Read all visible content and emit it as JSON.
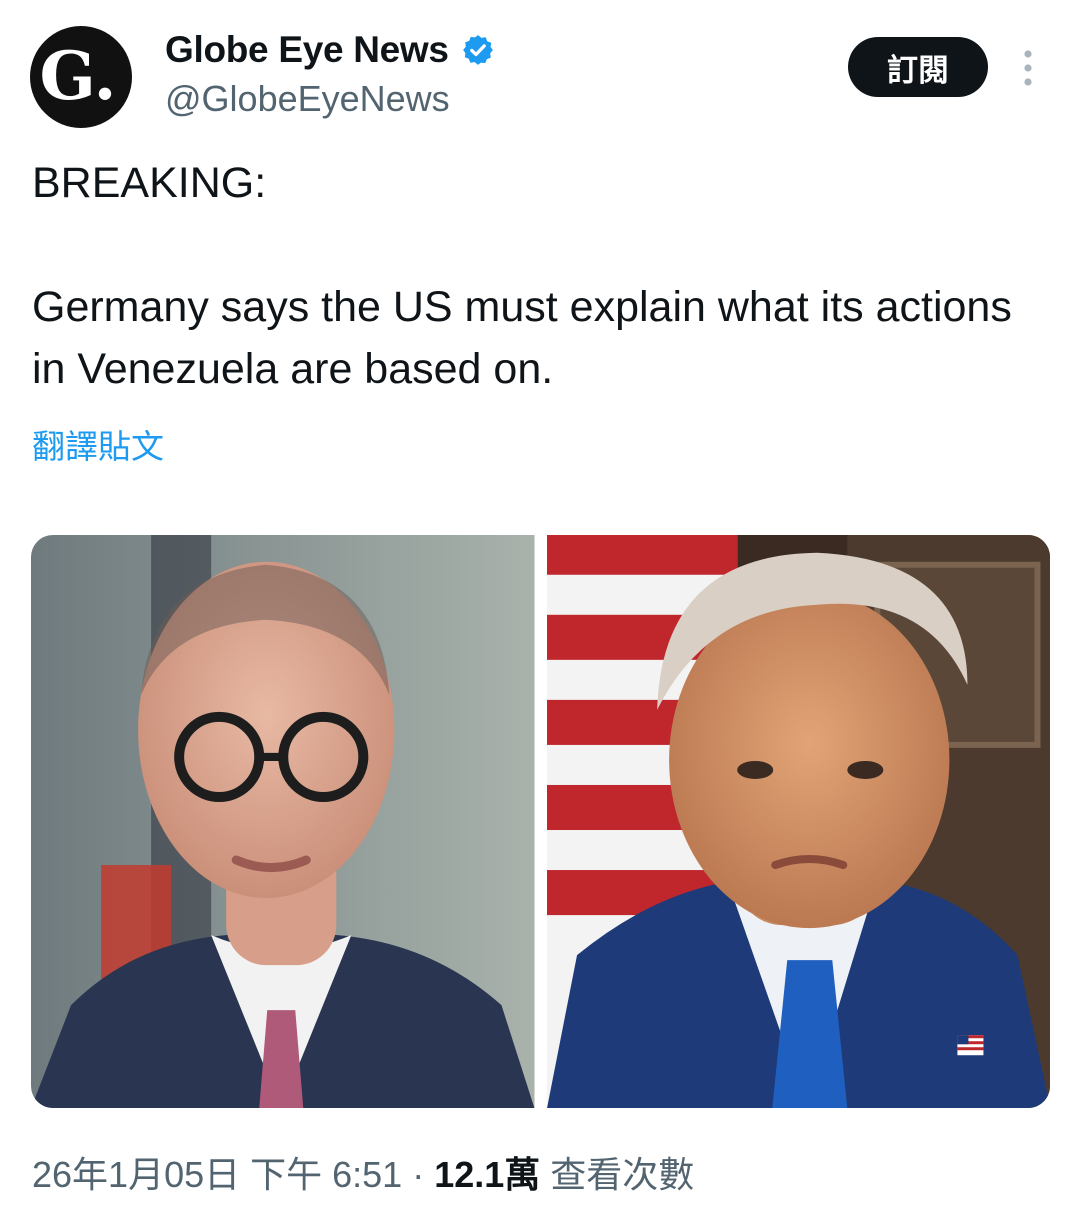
{
  "author": {
    "display_name": "Globe Eye News",
    "handle": "@GlobeEyeNews",
    "avatar_letter": "G.",
    "verified": true,
    "verified_color": "#1d9bf0"
  },
  "actions": {
    "subscribe_label": "訂閱",
    "more_icon": "more-vertical-icon"
  },
  "post": {
    "text": "BREAKING:\n\nGermany says the US must explain what its actions in Venezuela are based on.",
    "translate_label": "翻譯貼文",
    "media": [
      {
        "name": "photo-left",
        "description_icon": "photo"
      },
      {
        "name": "photo-right",
        "description_icon": "photo"
      }
    ]
  },
  "meta": {
    "date": "26年1月05日",
    "time": "下午 6:51",
    "separator": " · ",
    "views_count": "12.1萬",
    "views_label": "查看次數"
  },
  "colors": {
    "text_primary": "#0f1419",
    "text_secondary": "#536471",
    "link": "#1d9bf0",
    "button_bg": "#0f1419"
  }
}
